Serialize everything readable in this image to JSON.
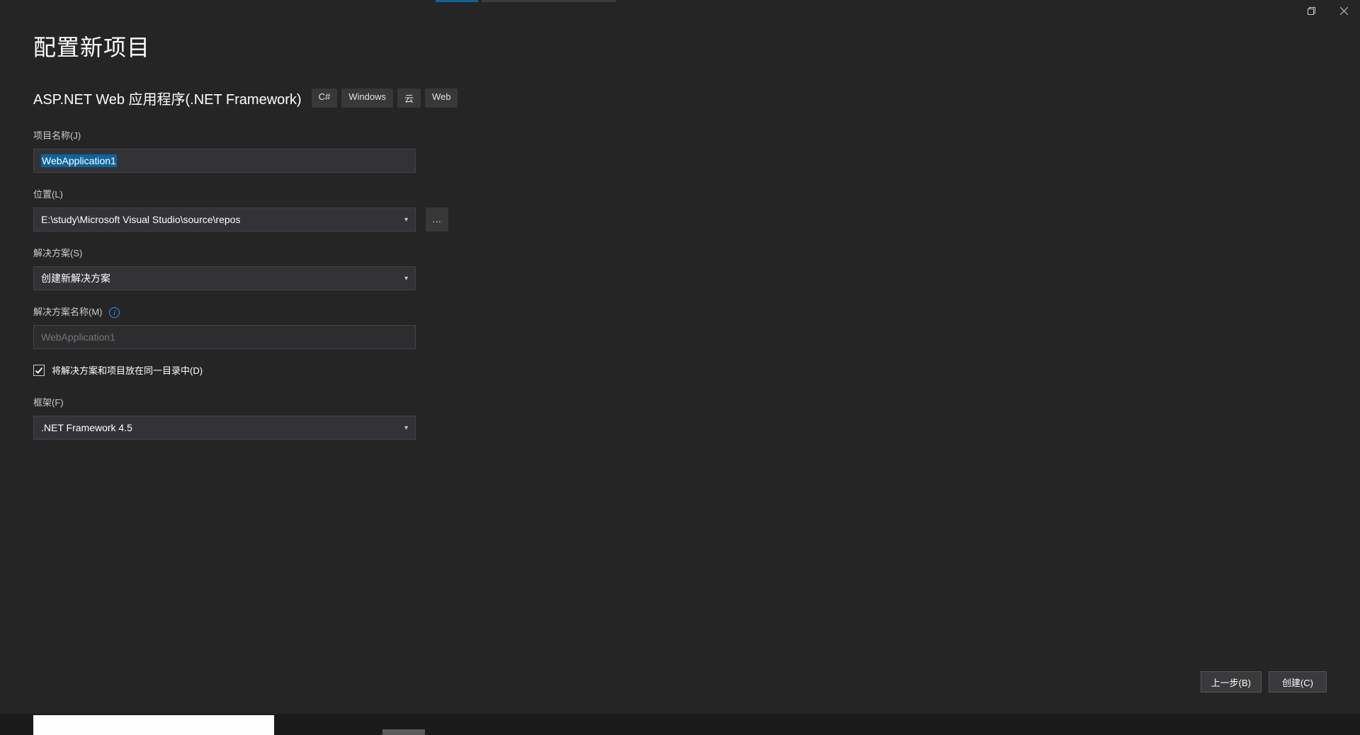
{
  "page": {
    "title": "配置新项目"
  },
  "project": {
    "type": "ASP.NET Web 应用程序(.NET Framework)",
    "tags": [
      "C#",
      "Windows",
      "云",
      "Web"
    ]
  },
  "form": {
    "projectName": {
      "label": "项目名称(J)",
      "value": "WebApplication1"
    },
    "location": {
      "label": "位置(L)",
      "value": "E:\\study\\Microsoft Visual Studio\\source\\repos",
      "browse": "..."
    },
    "solution": {
      "label": "解决方案(S)",
      "value": "创建新解决方案"
    },
    "solutionName": {
      "label": "解决方案名称(M)",
      "placeholder": "WebApplication1"
    },
    "sameDir": {
      "label": "将解决方案和项目放在同一目录中(D)",
      "checked": true
    },
    "framework": {
      "label": "框架(F)",
      "value": ".NET Framework 4.5"
    }
  },
  "buttons": {
    "back": "上一步(B)",
    "create": "创建(C)"
  }
}
